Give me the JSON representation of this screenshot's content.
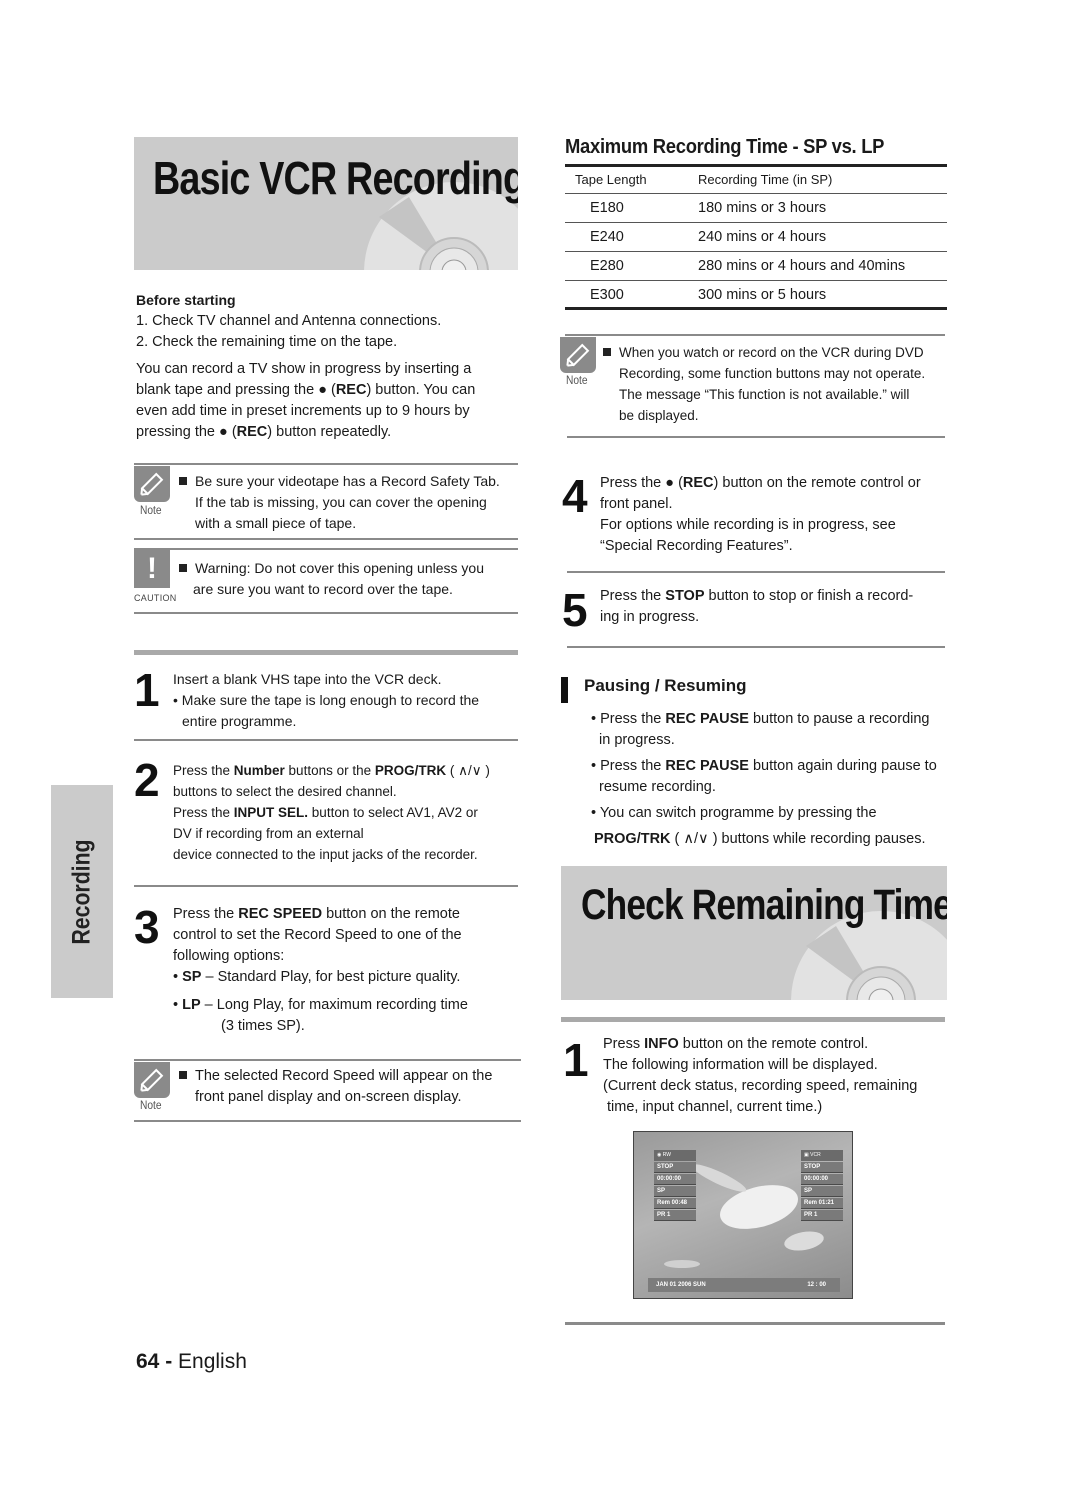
{
  "left": {
    "banner_title": "Basic VCR Recording",
    "before_starting": {
      "heading": "Before starting",
      "items": [
        "1. Check TV channel and Antenna connections.",
        "2. Check the remaining time on the tape."
      ]
    },
    "intro": {
      "l1": "You can record a TV show in progress by inserting a",
      "l2a": "blank tape and pressing the ",
      "l2_glyph": "●",
      "l2b": " (",
      "l2_bold": "REC",
      "l2c": ") button. You can",
      "l3": "even add time in preset increments up to 9 hours by",
      "l4a": "pressing the ",
      "l4_glyph": "●",
      "l4b": " (",
      "l4_bold": "REC",
      "l4c": ") button repeatedly."
    },
    "note1": {
      "label": "Note",
      "lines": [
        "Be sure your videotape has a Record Safety Tab.",
        "If the tab is missing, you can cover the opening",
        "with a small piece of tape."
      ]
    },
    "caution": {
      "label": "CAUTION",
      "glyph": "!",
      "lines": [
        "Warning: Do not cover this opening unless you",
        "are sure you want to record over the tape."
      ]
    },
    "step1": {
      "num": "1",
      "line1": "Insert a blank VHS tape into the VCR deck.",
      "bullet": "• Make sure the tape is long enough to record the",
      "bullet_cont": "entire programme."
    },
    "step2": {
      "num": "2",
      "l1a": "Press the ",
      "l1_bold1": "Number",
      "l1b": " buttons or the ",
      "l1_bold2": "PROG/TRK",
      "l1c": " ( ∧/∨ )",
      "l2": "buttons to select the desired channel.",
      "l3a": "Press the ",
      "l3_bold": "INPUT SEL.",
      "l3b": " button to select AV1, AV2 or",
      "l4": "DV if recording from an external",
      "l5": "device connected to the input jacks of the recorder."
    },
    "step3": {
      "num": "3",
      "l1a": "Press the ",
      "l1_bold": "REC SPEED",
      "l1b": " button on the remote",
      "l2": "control to set the Record Speed to one of the",
      "l3": "following options:",
      "sp_bold": "SP",
      "sp_text": " – Standard Play, for best picture quality.",
      "lp_bold": "LP",
      "lp_text": " – Long Play, for maximum recording time",
      "lp_cont": "(3 times SP)."
    },
    "note2": {
      "label": "Note",
      "lines": [
        "The selected Record Speed will appear on the",
        "front panel display and on-screen display."
      ]
    }
  },
  "right": {
    "table_title": "Maximum Recording Time - SP vs. LP",
    "table": {
      "headers": [
        "Tape Length",
        "Recording Time (in SP)"
      ],
      "rows": [
        [
          "E180",
          "180 mins or 3 hours"
        ],
        [
          "E240",
          "240 mins or 4 hours"
        ],
        [
          "E280",
          "280 mins or 4 hours and 40mins"
        ],
        [
          "E300",
          "300 mins or 5 hours"
        ]
      ]
    },
    "note3": {
      "label": "Note",
      "lines": [
        "When you watch or record on the VCR during DVD",
        "Recording, some function buttons may not operate.",
        "The message “This function is not available.” will",
        "be displayed."
      ]
    },
    "step4": {
      "num": "4",
      "l1a": "Press the ",
      "l1_glyph": "●",
      "l1b": " (",
      "l1_bold": "REC",
      "l1c": ") button on the remote control or",
      "l2": "front panel.",
      "l3": "For options while recording is in progress, see",
      "l4": "“Special Recording Features”."
    },
    "step5": {
      "num": "5",
      "l1a": "Press the ",
      "l1_bold": "STOP",
      "l1b": " button to stop or finish a record-",
      "l2": "ing in progress."
    },
    "pausing": {
      "heading": "Pausing / Resuming",
      "b1a": "• Press the ",
      "b1_bold": "REC PAUSE",
      "b1b": " button to pause a recording",
      "b1_cont": "in progress.",
      "b2a": "• Press the ",
      "b2_bold": "REC PAUSE",
      "b2b": " button again during pause to",
      "b2_cont": "resume recording.",
      "b3": "• You can switch programme by pressing the",
      "b3_bold": "PROG/TRK",
      "b3_cont": " ( ∧/∨ ) buttons while recording pauses."
    },
    "banner_title": "Check Remaining Time",
    "info_step": {
      "num": "1",
      "l1a": "Press ",
      "l1_bold": "INFO",
      "l1b": " button on the remote control.",
      "l2": "The following information will be displayed.",
      "l3": "(Current deck status, recording speed, remaining",
      "l4": "time, input channel, current time.)"
    },
    "osd": {
      "left_panel": {
        "header": "RW",
        "rows": [
          "STOP",
          "00:00:00",
          "SP",
          "Rem 00:48",
          "PR 1"
        ]
      },
      "right_panel": {
        "header": "VCR",
        "rows": [
          "STOP",
          "00:00:00",
          "SP",
          "Rem 01:21",
          "PR 1"
        ]
      },
      "date": "JAN 01 2006 SUN",
      "time": "12 : 00"
    }
  },
  "side_tab": "Recording",
  "footer": {
    "page_num": "64 -",
    "language": "English"
  }
}
